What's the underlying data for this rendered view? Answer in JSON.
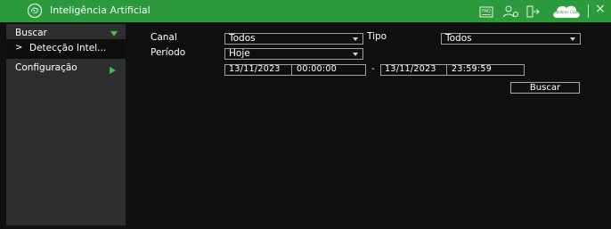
{
  "app": {
    "title": "Inteligência Artificial"
  },
  "toolbar": {
    "icons": [
      "faq-icon",
      "users-icon",
      "logout-icon",
      "cloud-icon",
      "close-icon"
    ],
    "faq_label": "FAQ",
    "cloud_label": "Intelbras Cloud",
    "close_label": "×"
  },
  "sidebar": {
    "items": [
      {
        "label": "Buscar"
      },
      {
        "label": "Detecção Intel..."
      },
      {
        "label": "Configuração"
      }
    ],
    "bullet": ">"
  },
  "form": {
    "canal": {
      "label": "Canal",
      "value": "Todos"
    },
    "tipo": {
      "label": "Tipo",
      "value": "Todos"
    },
    "periodo": {
      "label": "Período",
      "value": "Hoje"
    },
    "start": {
      "date": "13/11/2023",
      "time": "00:00:00"
    },
    "range_separator": "-",
    "end": {
      "date": "13/11/2023",
      "time": "23:59:59"
    },
    "search_button": "Buscar"
  },
  "colors": {
    "accent": "#2a9a3c",
    "arrow": "#3bbf4e",
    "sidebar_bg": "#2c2f2d",
    "background": "#0f1110"
  }
}
